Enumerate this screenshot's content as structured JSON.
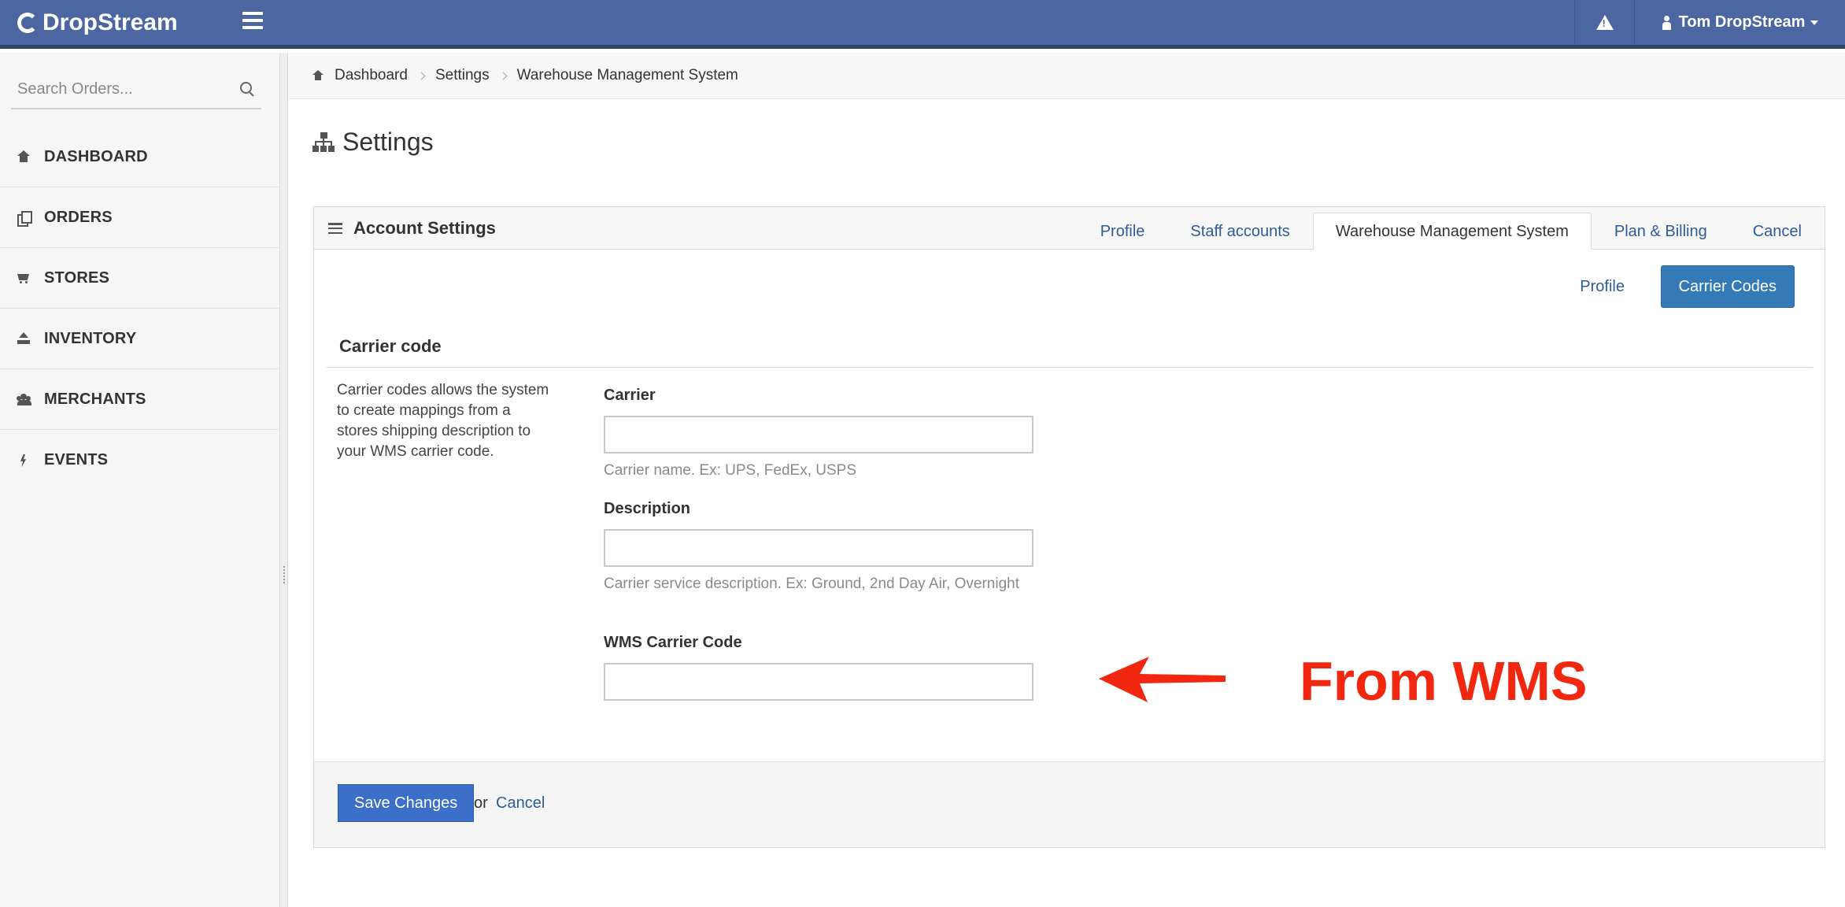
{
  "topbar": {
    "brand": "DropStream",
    "user_name": "Tom DropStream"
  },
  "sidebar": {
    "search_placeholder": "Search Orders...",
    "items": [
      {
        "label": "DASHBOARD",
        "icon": "home-icon"
      },
      {
        "label": "ORDERS",
        "icon": "orders-icon"
      },
      {
        "label": "STORES",
        "icon": "cart-icon"
      },
      {
        "label": "INVENTORY",
        "icon": "upload-icon"
      },
      {
        "label": "MERCHANTS",
        "icon": "users-icon"
      },
      {
        "label": "EVENTS",
        "icon": "bolt-icon"
      }
    ]
  },
  "breadcrumb": [
    "Dashboard",
    "Settings",
    "Warehouse Management System"
  ],
  "page_title": "Settings",
  "panel": {
    "title": "Account Settings",
    "tabs": [
      {
        "label": "Profile",
        "active": false
      },
      {
        "label": "Staff accounts",
        "active": false
      },
      {
        "label": "Warehouse Management System",
        "active": true
      },
      {
        "label": "Plan & Billing",
        "active": false
      },
      {
        "label": "Cancel",
        "active": false
      }
    ],
    "sub_nav": {
      "profile": "Profile",
      "carrier_codes": "Carrier Codes"
    },
    "section_title": "Carrier code",
    "section_description": "Carrier codes allows the system to create mappings from a stores shipping description to your WMS carrier code.",
    "fields": [
      {
        "label": "Carrier",
        "value": "",
        "help": "Carrier name. Ex: UPS, FedEx, USPS"
      },
      {
        "label": "Description",
        "value": "",
        "help": "Carrier service description. Ex: Ground, 2nd Day Air, Overnight"
      },
      {
        "label": "WMS Carrier Code",
        "value": "",
        "help": ""
      }
    ],
    "annotation": "From WMS",
    "footer": {
      "save_label": "Save Changes",
      "or_text": "or",
      "cancel_label": "Cancel"
    }
  },
  "colors": {
    "topbar": "#4b66a0",
    "primary_button": "#337ab7",
    "save_button": "#3c6fc9",
    "link": "#2d5c99",
    "annotation": "#f2270f"
  }
}
